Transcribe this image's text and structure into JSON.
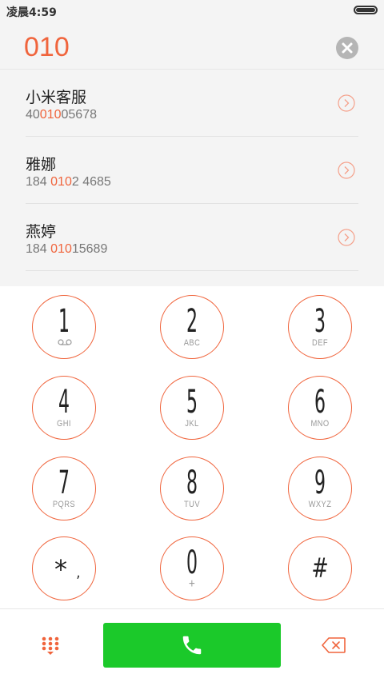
{
  "status_bar": {
    "time": "凌晨4:59",
    "battery_level": 1.0
  },
  "input": {
    "number": "010"
  },
  "results": [
    {
      "name": "小米客服",
      "number_pre": "40",
      "number_match": "010",
      "number_post": "05678"
    },
    {
      "name": "雅娜",
      "number_pre": "184 ",
      "number_match": "010",
      "number_post": "2 4685"
    },
    {
      "name": "燕婷",
      "number_pre": "184 ",
      "number_match": "010",
      "number_post": "15689"
    }
  ],
  "keypad": {
    "k1": {
      "digit": "1",
      "letters": "",
      "icon": "voicemail-icon"
    },
    "k2": {
      "digit": "2",
      "letters": "ABC"
    },
    "k3": {
      "digit": "3",
      "letters": "DEF"
    },
    "k4": {
      "digit": "4",
      "letters": "GHI"
    },
    "k5": {
      "digit": "5",
      "letters": "JKL"
    },
    "k6": {
      "digit": "6",
      "letters": "MNO"
    },
    "k7": {
      "digit": "7",
      "letters": "PQRS"
    },
    "k8": {
      "digit": "8",
      "letters": "TUV"
    },
    "k9": {
      "digit": "9",
      "letters": "WXYZ"
    },
    "kstar": {
      "digit": "*",
      "letters": ","
    },
    "k0": {
      "digit": "0",
      "letters": "+"
    },
    "khash": {
      "digit": "#",
      "letters": ""
    }
  },
  "colors": {
    "accent": "#f0643c",
    "call_green": "#1bc92a",
    "panel_bg": "#f4f4f4"
  },
  "icons": {
    "clear": "clear-icon",
    "arrow": "chevron-right-circle-icon",
    "dialpad": "dialpad-icon",
    "call": "phone-icon",
    "backspace": "backspace-icon"
  }
}
